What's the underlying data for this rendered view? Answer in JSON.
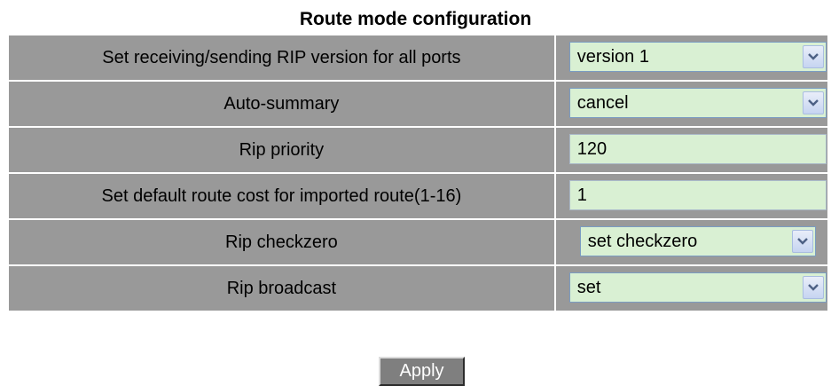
{
  "title": "Route mode configuration",
  "rows": [
    {
      "label": "Set receiving/sending RIP version for all ports",
      "control": "select",
      "value": "version 1"
    },
    {
      "label": "Auto-summary",
      "control": "select",
      "value": "cancel"
    },
    {
      "label": "Rip priority",
      "control": "text",
      "value": "120"
    },
    {
      "label": "Set default route cost for imported route(1-16)",
      "control": "text",
      "value": "1"
    },
    {
      "label": "Rip checkzero",
      "control": "select",
      "value": "set checkzero"
    },
    {
      "label": "Rip broadcast",
      "control": "select",
      "value": "set"
    }
  ],
  "apply_label": "Apply",
  "icons": {
    "dropdown": "chevron-down-icon"
  },
  "colors": {
    "label_bg": "#999999",
    "field_bg": "#d9f0d3",
    "button_bg": "#7f7f7f",
    "arrow": "#4d6185"
  }
}
